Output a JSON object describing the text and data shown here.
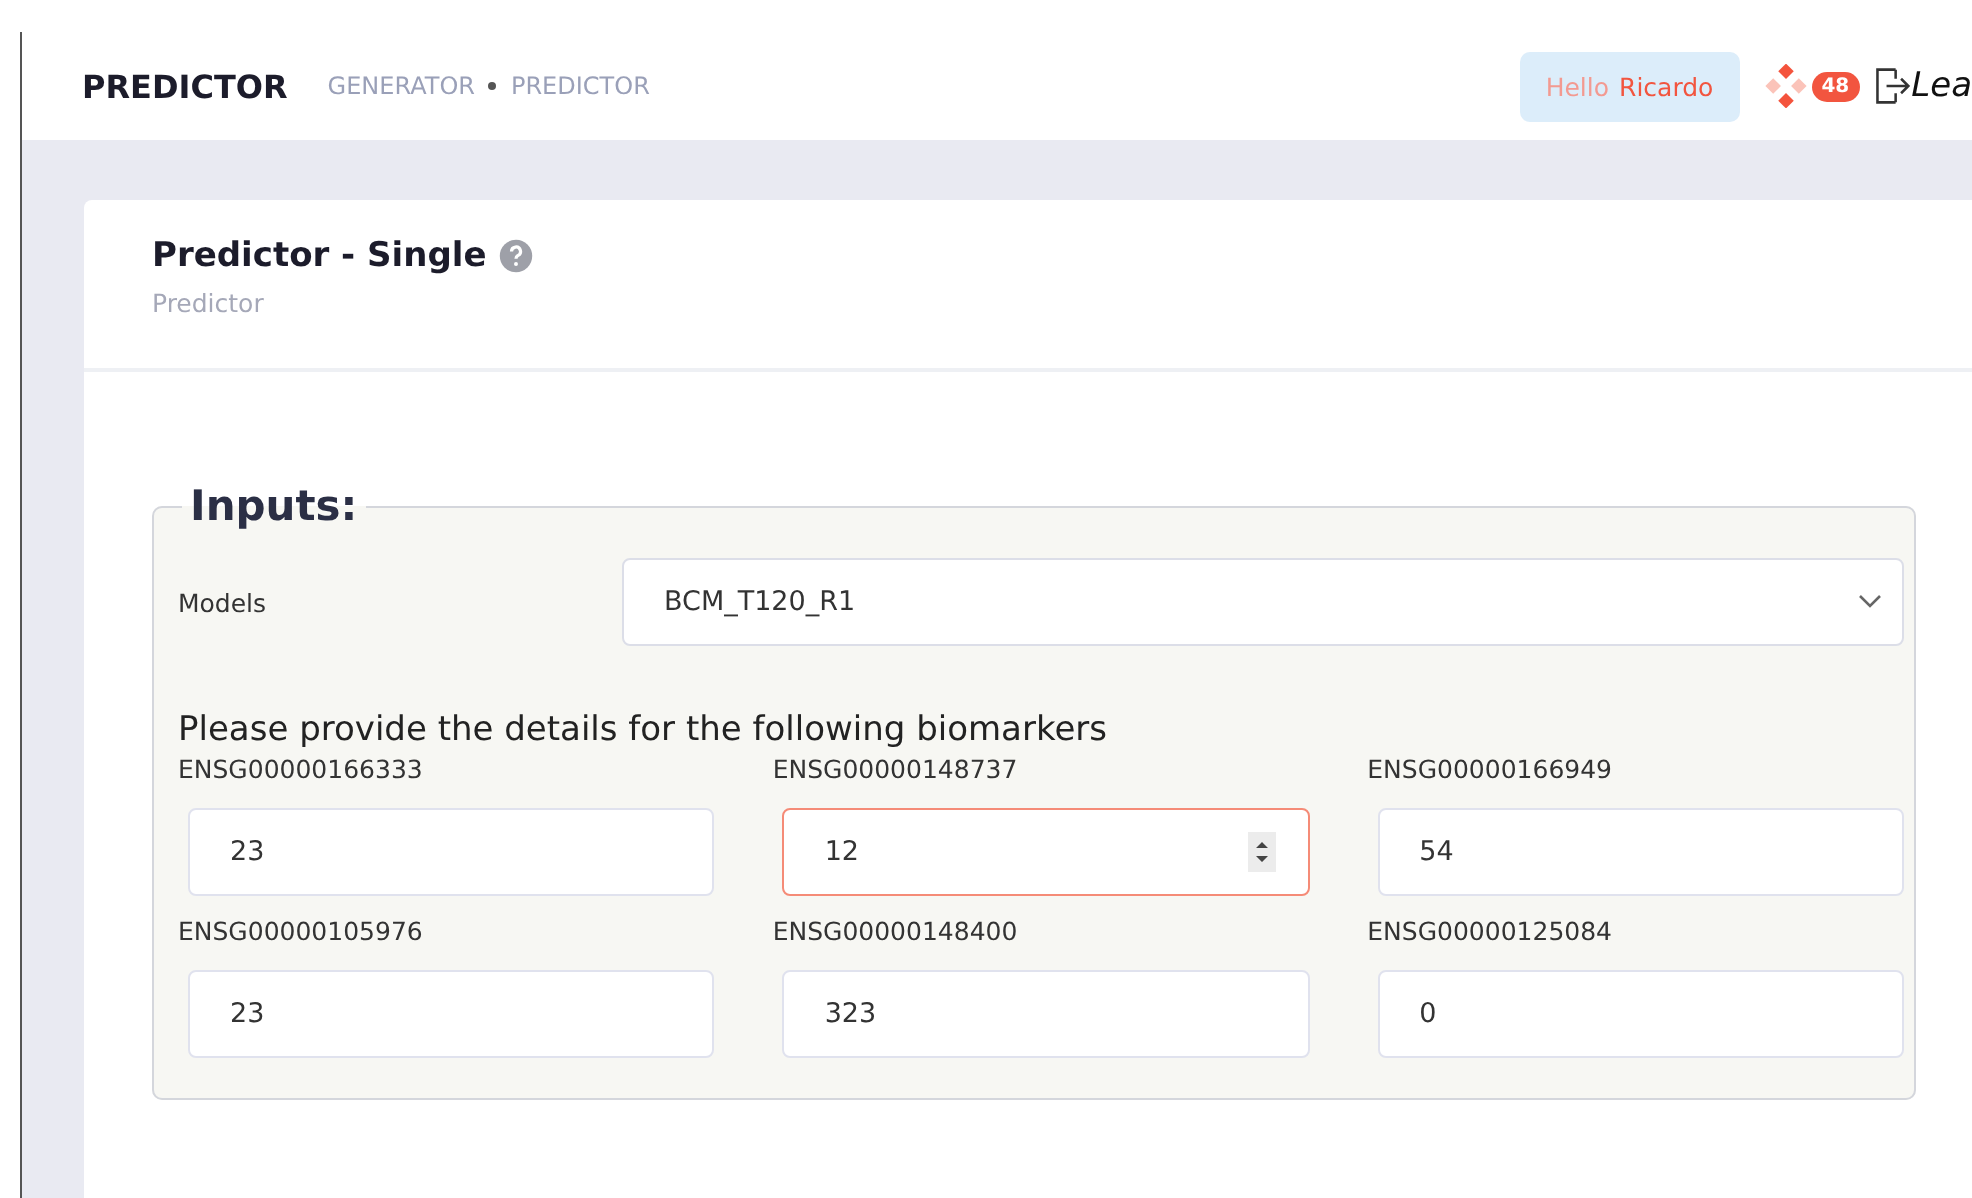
{
  "header": {
    "title": "PREDICTOR",
    "breadcrumb": [
      "GENERATOR",
      "PREDICTOR"
    ],
    "greeting": "Hello",
    "user": "Ricardo",
    "badge": "48",
    "logout": "Lea"
  },
  "card": {
    "title": "Predictor - Single",
    "subtitle": "Predictor"
  },
  "inputs": {
    "legend": "Inputs:",
    "model_label": "Models",
    "model_value": "BCM_T120_R1",
    "prompt": "Please provide the details for the following biomarkers",
    "fields": [
      {
        "label": "ENSG00000166333",
        "value": "23",
        "focused": false
      },
      {
        "label": "ENSG00000148737",
        "value": "12",
        "focused": true
      },
      {
        "label": "ENSG00000166949",
        "value": "54",
        "focused": false
      },
      {
        "label": "ENSG00000105976",
        "value": "23",
        "focused": false
      },
      {
        "label": "ENSG00000148400",
        "value": "323",
        "focused": false
      },
      {
        "label": "ENSG00000125084",
        "value": "0",
        "focused": false
      }
    ]
  }
}
